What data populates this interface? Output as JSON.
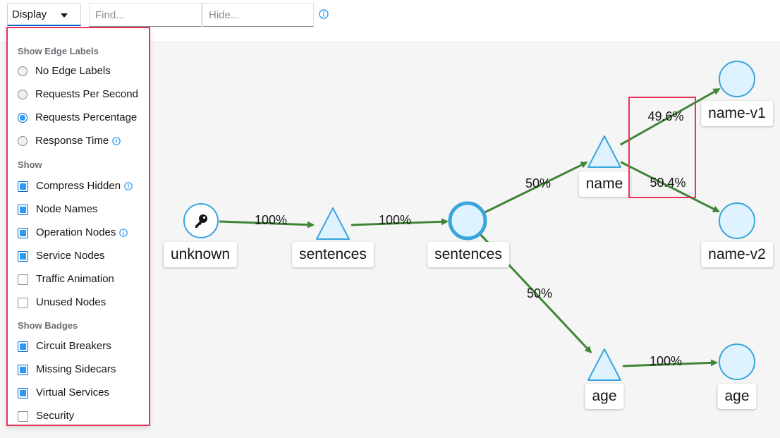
{
  "toolbar": {
    "display_label": "Display",
    "find_placeholder": "Find...",
    "hide_placeholder": "Hide..."
  },
  "colors": {
    "edge": "#3e8635",
    "node_fill": "#def3ff",
    "node_stroke": "#39a5dc",
    "highlight": "#e8335a",
    "checked": "#2b9af3"
  },
  "display_menu": {
    "edge_labels_heading": "Show Edge Labels",
    "edge_label_options": [
      {
        "label": "No Edge Labels",
        "selected": false
      },
      {
        "label": "Requests Per Second",
        "selected": false
      },
      {
        "label": "Requests Percentage",
        "selected": true
      },
      {
        "label": "Response Time",
        "selected": false
      }
    ],
    "show_heading": "Show",
    "show_options": [
      {
        "label": "Compress Hidden",
        "checked": true
      },
      {
        "label": "Node Names",
        "checked": true
      },
      {
        "label": "Operation Nodes",
        "checked": true
      },
      {
        "label": "Service Nodes",
        "checked": true
      },
      {
        "label": "Traffic Animation",
        "checked": false
      },
      {
        "label": "Unused Nodes",
        "checked": false
      }
    ],
    "badges_heading": "Show Badges",
    "badge_options": [
      {
        "label": "Circuit Breakers",
        "checked": true
      },
      {
        "label": "Missing Sidecars",
        "checked": true
      },
      {
        "label": "Virtual Services",
        "checked": true
      },
      {
        "label": "Security",
        "checked": false
      }
    ]
  },
  "graph": {
    "nodes": [
      {
        "id": "unknown",
        "label": "unknown",
        "shape": "circle",
        "icon": "key-icon"
      },
      {
        "id": "sentences-app",
        "label": "sentences",
        "shape": "triangle"
      },
      {
        "id": "sentences-svc",
        "label": "sentences",
        "shape": "circle"
      },
      {
        "id": "name-app",
        "label": "name",
        "shape": "triangle"
      },
      {
        "id": "age-app",
        "label": "age",
        "shape": "triangle"
      },
      {
        "id": "name-v1",
        "label": "name-v1",
        "shape": "circle"
      },
      {
        "id": "name-v2",
        "label": "name-v2",
        "shape": "circle"
      },
      {
        "id": "age-svc",
        "label": "age",
        "shape": "circle"
      }
    ],
    "edges": [
      {
        "from": "unknown",
        "to": "sentences-app",
        "label": "100%"
      },
      {
        "from": "sentences-app",
        "to": "sentences-svc",
        "label": "100%"
      },
      {
        "from": "sentences-svc",
        "to": "name-app",
        "label": "50%"
      },
      {
        "from": "sentences-svc",
        "to": "age-app",
        "label": "50%"
      },
      {
        "from": "name-app",
        "to": "name-v1",
        "label": "49.6%"
      },
      {
        "from": "name-app",
        "to": "name-v2",
        "label": "50.4%"
      },
      {
        "from": "age-app",
        "to": "age-svc",
        "label": "100%"
      }
    ]
  }
}
